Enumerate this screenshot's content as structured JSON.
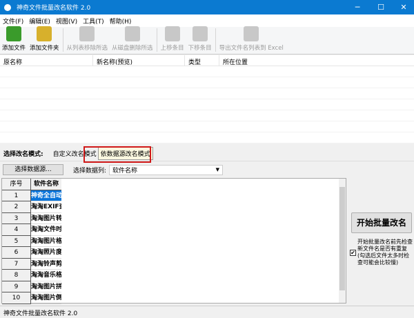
{
  "title": "神奇文件批量改名软件 2.0",
  "menu": [
    "文件(F)",
    "编辑(E)",
    "视图(V)",
    "工具(T)",
    "帮助(H)"
  ],
  "toolbar": [
    {
      "label": "添加文件",
      "enabled": true,
      "icon": "add-file-icon",
      "color": "#3a9b2b"
    },
    {
      "label": "添加文件夹",
      "enabled": true,
      "icon": "add-folder-icon",
      "color": "#d7b02c"
    },
    {
      "label": "从列表移除所选",
      "enabled": false,
      "icon": "remove-from-list-icon",
      "color": "#c8c8c8"
    },
    {
      "label": "从磁盘删除所选",
      "enabled": false,
      "icon": "delete-from-disk-icon",
      "color": "#c8c8c8"
    },
    {
      "label": "上移条目",
      "enabled": false,
      "icon": "arrow-up-icon",
      "color": "#c8c8c8"
    },
    {
      "label": "下移条目",
      "enabled": false,
      "icon": "arrow-down-icon",
      "color": "#c8c8c8"
    },
    {
      "label": "导出文件名列表到 Excel",
      "enabled": false,
      "icon": "excel-export-icon",
      "color": "#c8c8c8"
    }
  ],
  "list_columns": [
    "原名称",
    "新名称(预览)",
    "类型",
    "所在位置"
  ],
  "mode": {
    "label": "选择改名模式:",
    "tabs": [
      "自定义改名模式",
      "依数据源改名模式"
    ]
  },
  "datasource": {
    "button": "选择数据源...",
    "column_label": "选择数据列:",
    "column_value": "软件名称"
  },
  "grid": {
    "headers": [
      "序号",
      "软件名称"
    ],
    "rows": [
      [
        "1",
        "神奇全自动"
      ],
      [
        "2",
        "淘淘EXIF查"
      ],
      [
        "3",
        "淘淘图片转"
      ],
      [
        "4",
        "淘淘文件时"
      ],
      [
        "5",
        "淘淘图片格"
      ],
      [
        "6",
        "淘淘照片度"
      ],
      [
        "7",
        "淘淘铃声剪"
      ],
      [
        "8",
        "淘淘音乐格"
      ],
      [
        "9",
        "淘淘图片拼"
      ],
      [
        "10",
        "淘淘图片倒"
      ]
    ]
  },
  "start_button": "开始批量改名",
  "check_option": {
    "label": "开始批量改名前先检查新文件名是否有重复(勾选后文件太多时检查可能会比较慢)",
    "checked": true
  },
  "status": "神奇文件批量改名软件 2.0"
}
